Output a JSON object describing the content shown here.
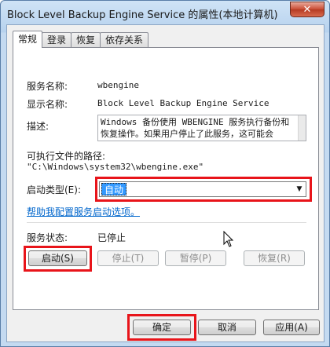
{
  "window": {
    "title": "Block Level Backup Engine Service 的属性(本地计算机)",
    "close_label": "✕"
  },
  "tabs": [
    {
      "label": "常规",
      "active": true
    },
    {
      "label": "登录",
      "active": false
    },
    {
      "label": "恢复",
      "active": false
    },
    {
      "label": "依存关系",
      "active": false
    }
  ],
  "general": {
    "service_name_label": "服务名称:",
    "service_name_value": "wbengine",
    "display_name_label": "显示名称:",
    "display_name_value": "Block Level Backup Engine Service",
    "description_label": "描述:",
    "description_line1": "Windows 备份使用 WBENGINE 服务执行备份和",
    "description_line2": "恢复操作。如果用户停止了此服务，这可能会",
    "exe_path_label": "可执行文件的路径:",
    "exe_path_value": "\"C:\\Windows\\system32\\wbengine.exe\"",
    "startup_type_label": "启动类型(E):",
    "startup_type_value": "自动",
    "help_link": "帮助我配置服务启动选项。",
    "status_label": "服务状态:",
    "status_value": "已停止"
  },
  "service_buttons": {
    "start": "启动(S)",
    "stop": "停止(T)",
    "pause": "暂停(P)",
    "resume": "恢复(R)"
  },
  "dialog_buttons": {
    "ok": "确定",
    "cancel": "取消",
    "apply": "应用(A)"
  },
  "highlight_color": "#e8141a",
  "icons": [
    "close-icon",
    "dropdown-arrow-icon",
    "mouse-cursor-icon"
  ]
}
